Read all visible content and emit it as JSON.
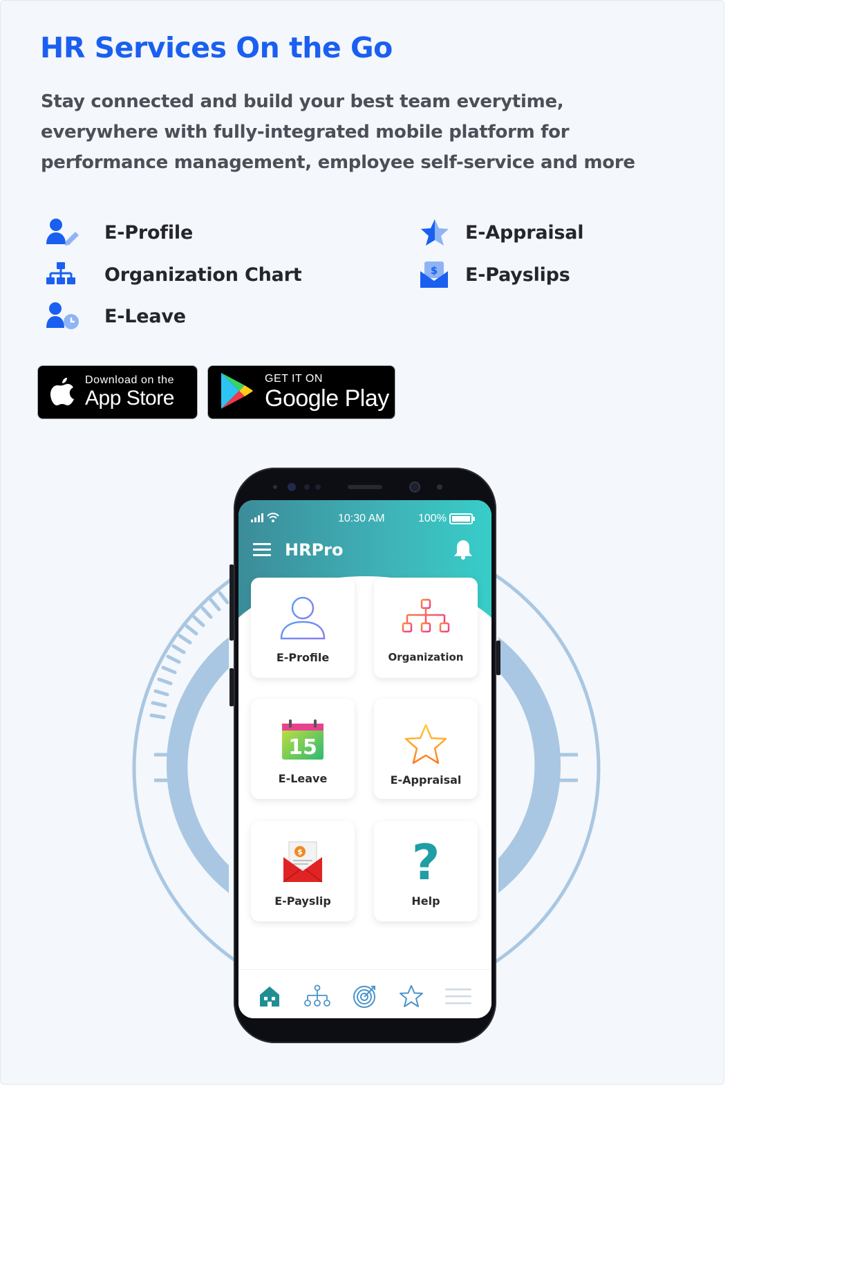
{
  "headline": "HR Services On the Go",
  "lead": "Stay connected and build your best team everytime, everywhere with fully-integrated mobile platform for performance management, employee self-service and more",
  "features": [
    {
      "label": "E-Profile",
      "icon": "user-edit-icon"
    },
    {
      "label": "Organization Chart",
      "icon": "org-chart-icon"
    },
    {
      "label": "E-Leave",
      "icon": "user-clock-icon"
    },
    {
      "label": "E-Appraisal",
      "icon": "star-icon"
    },
    {
      "label": "E-Payslips",
      "icon": "payslip-envelope-icon"
    }
  ],
  "stores": {
    "apple": {
      "small": "Download on the",
      "big": "App Store"
    },
    "google": {
      "small": "GET IT ON",
      "big": "Google Play"
    }
  },
  "phone": {
    "status": {
      "time": "10:30 AM",
      "battery": "100%"
    },
    "app_title": "HRPro",
    "tiles": [
      {
        "label": "E-Profile",
        "icon": "user-outline-icon"
      },
      {
        "label": "Organization",
        "icon": "org-chart-icon"
      },
      {
        "label": "E-Leave",
        "icon": "calendar-icon",
        "calendar_day": "15"
      },
      {
        "label": "E-Appraisal",
        "icon": "star-outline-icon"
      },
      {
        "label": "E-Payslip",
        "icon": "payslip-envelope-icon"
      },
      {
        "label": "Help",
        "icon": "question-mark-icon"
      }
    ],
    "bottom_nav": [
      "home-icon",
      "org-chart-icon",
      "target-icon",
      "star-outline-icon",
      "menu-icon"
    ]
  },
  "colors": {
    "accent_blue": "#1a5ff0",
    "teal": "#3fb3b8",
    "deco_blue": "#a9c7e2"
  }
}
